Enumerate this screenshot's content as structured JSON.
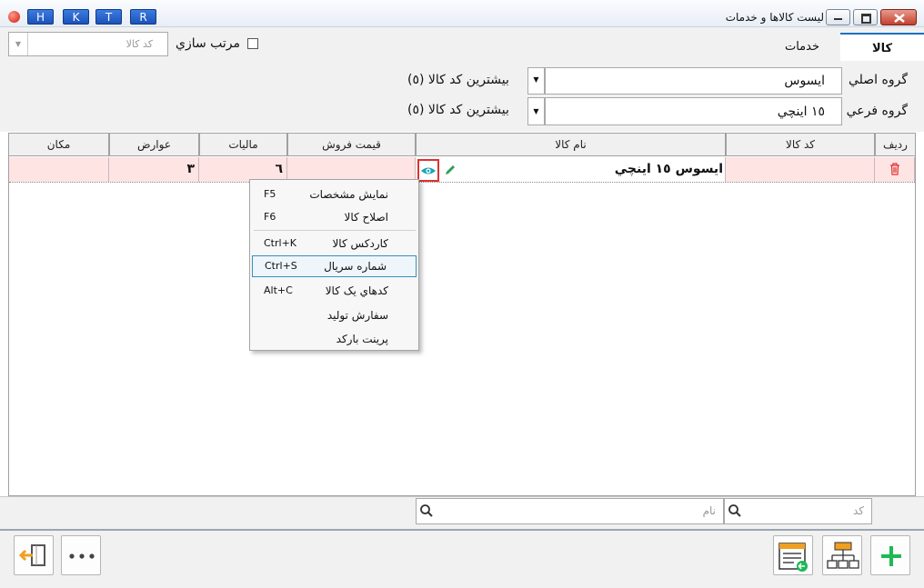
{
  "window": {
    "title": "ليست کالاها و خدمات",
    "shortcut_buttons": [
      "H",
      "K",
      "T",
      "R"
    ]
  },
  "tabs": [
    {
      "label": "کالا",
      "active": true
    },
    {
      "label": "خدمات",
      "active": false
    }
  ],
  "sort": {
    "checkbox_label": "مرتب سازي",
    "field_placeholder": "کد کالا",
    "checked": false
  },
  "filters": {
    "main_group_label": "گروه اصلي",
    "main_group_value": "ايسوس",
    "main_group_hint": "بيشترين کد کالا (٥)",
    "sub_group_label": "گروه فرعي",
    "sub_group_value": "١٥ اينچي",
    "sub_group_hint": "بيشترين کد کالا (٥)"
  },
  "table": {
    "columns": [
      "رديف",
      "کد کالا",
      "نام کالا",
      "قيمت فروش",
      "ماليات",
      "عوارض",
      "مکان"
    ],
    "rows": [
      {
        "code": "",
        "name": "ايسوس ١٥ اينچي",
        "price": "",
        "tax": "٦",
        "duties": "٣",
        "location": ""
      }
    ]
  },
  "context_menu": {
    "items": [
      {
        "label": "نمايش مشخصات",
        "shortcut": "F5"
      },
      {
        "label": "اصلاح کالا",
        "shortcut": "F6"
      },
      {
        "label": "کاردکس کالا",
        "shortcut": "Ctrl+K"
      },
      {
        "label": "شماره سريال",
        "shortcut": "Ctrl+S",
        "highlighted": true
      },
      {
        "label": "کدهاي يک کالا",
        "shortcut": "Alt+C"
      },
      {
        "label": "سفارش توليد",
        "shortcut": ""
      },
      {
        "label": "پرينت بارکد",
        "shortcut": ""
      }
    ]
  },
  "search": {
    "code_placeholder": "کد",
    "name_placeholder": "نام"
  },
  "colors": {
    "accent": "#1d6fc4",
    "row_highlight": "#ffe4e4",
    "add_green": "#1db954",
    "eye_teal": "#1aa3b6",
    "delete_red": "#e03030"
  },
  "icons": {
    "exit": "exit-door-icon",
    "more": "more-dots-icon",
    "report": "report-list-icon",
    "tree": "hierarchy-tree-icon",
    "add": "plus-icon"
  }
}
